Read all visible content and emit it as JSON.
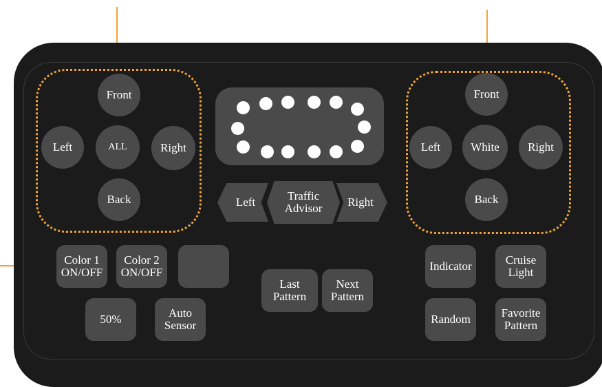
{
  "colors": {
    "accent": "#f0a43a",
    "panel": "#1b1b1b",
    "button": "#4a4a4a",
    "text": "#ffffff"
  },
  "left_group": {
    "front": "Front",
    "left": "Left",
    "all": "ALL",
    "right": "Right",
    "back": "Back"
  },
  "right_group": {
    "front": "Front",
    "left": "Left",
    "white": "White",
    "right": "Right",
    "back": "Back"
  },
  "traffic_advisor": {
    "left": "Left",
    "center": "Traffic\nAdvisor",
    "right": "Right"
  },
  "buttons": {
    "color1": "Color 1\nON/OFF",
    "color2": "Color 2\nON/OFF",
    "blank": "",
    "dim": "50%",
    "auto_sensor": "Auto\nSensor",
    "last_pattern": "Last\nPattern",
    "next_pattern": "Next\nPattern",
    "indicator": "Indicator",
    "cruise_light": "Cruise\nLight",
    "random": "Random",
    "favorite_pattern": "Favorite\nPattern"
  },
  "led_count": 14
}
